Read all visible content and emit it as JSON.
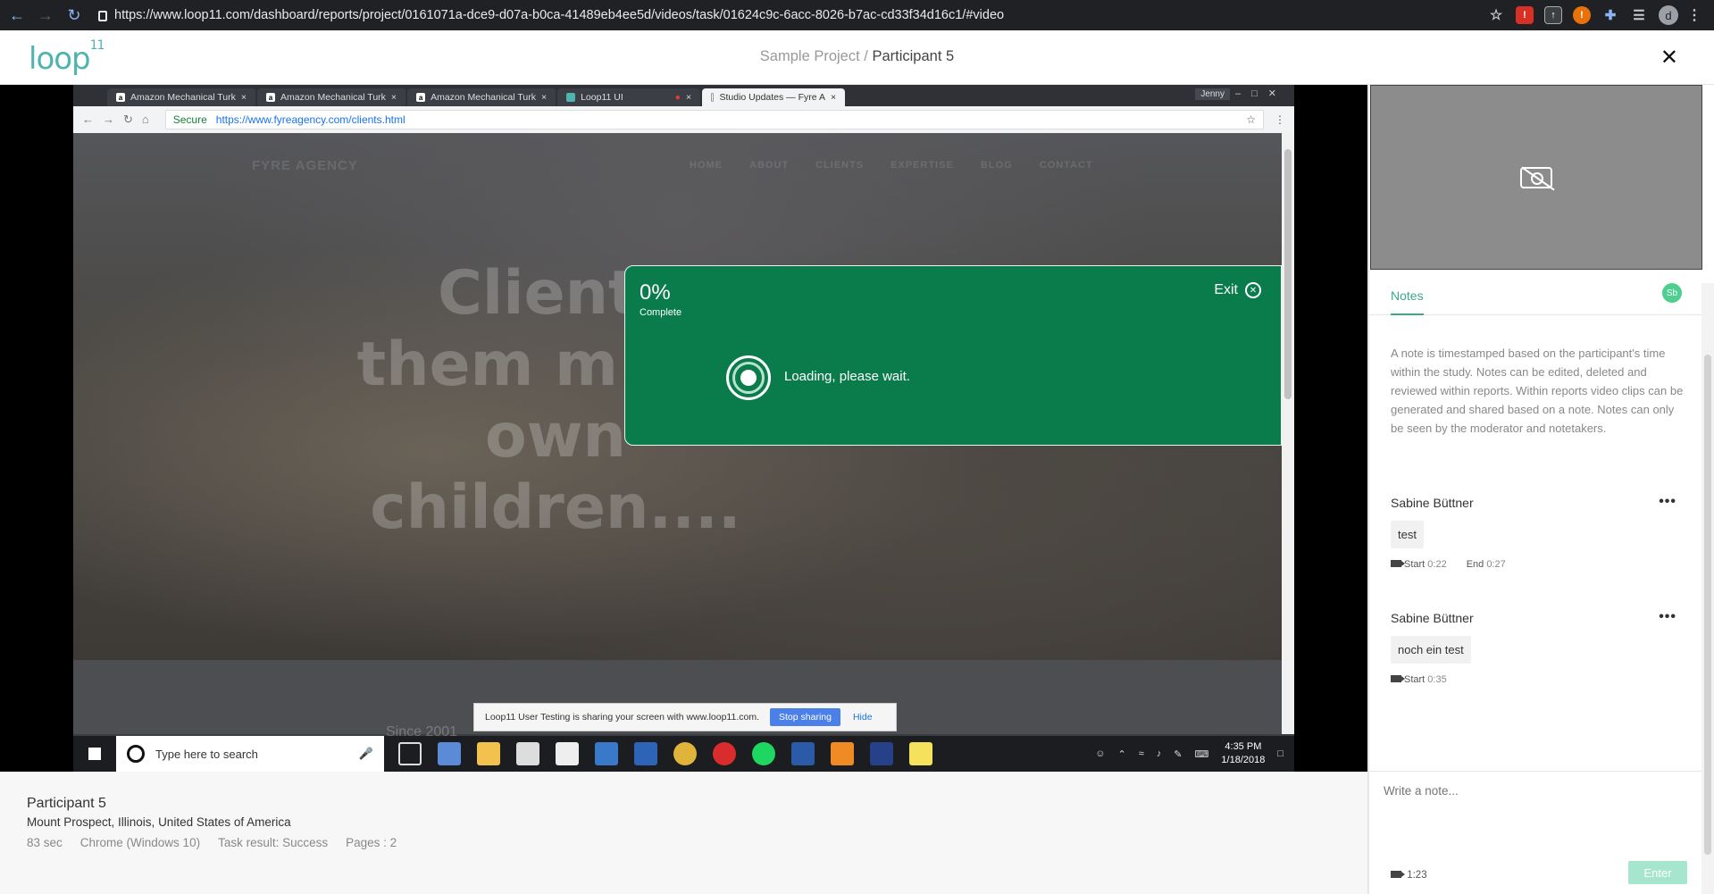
{
  "browser": {
    "url": "https://www.loop11.com/dashboard/reports/project/0161071a-dce9-d07a-b0ca-41489eb4ee5d/videos/task/01624c9c-6acc-8026-b7ac-cd33f34d16c1/#video",
    "avatar_letter": "d"
  },
  "header": {
    "logo": "loop",
    "logo_sup": "11",
    "project": "Sample Project",
    "separator": "/",
    "participant": "Participant 5"
  },
  "recording": {
    "tabs": [
      {
        "label": "Amazon Mechanical Turk"
      },
      {
        "label": "Amazon Mechanical Turk"
      },
      {
        "label": "Amazon Mechanical Turk"
      },
      {
        "label": "Loop11 UI"
      },
      {
        "label": "Studio Updates — Fyre A"
      }
    ],
    "user": "Jenny",
    "secure_label": "Secure",
    "address": "https://www.fyreagency.com/clients.html",
    "site_brand": "FYRE AGENCY",
    "site_menu": [
      "HOME",
      "ABOUT",
      "CLIENTS",
      "EXPERTISE",
      "BLOG",
      "CONTACT"
    ],
    "site_headline": "Clients them m our own children....",
    "site_lower_text": "Since 2001",
    "overlay": {
      "percent": "0%",
      "complete_label": "Complete",
      "exit_label": "Exit",
      "loading_text": "Loading, please wait."
    },
    "share_bar": {
      "message": "Loop11 User Testing is sharing your screen with www.loop11.com.",
      "stop_label": "Stop sharing",
      "hide_label": "Hide"
    },
    "taskbar": {
      "search_placeholder": "Type here to search",
      "time": "4:35 PM",
      "date": "1/18/2018"
    }
  },
  "participant_info": {
    "name": "Participant 5",
    "location": "Mount Prospect, Illinois, United States of America",
    "duration": "83 sec",
    "browser": "Chrome (Windows 10)",
    "task_result": "Task result: Success",
    "pages": "Pages : 2"
  },
  "notes_panel": {
    "tab_label": "Notes",
    "user_badge": "Sb",
    "intro": "A note is timestamped based on the participant's time within the study. Notes can be edited, deleted and reviewed within reports. Within reports video clips can be generated and shared based on a note. Notes can only be seen by the moderator and notetakers.",
    "notes": [
      {
        "author": "Sabine Büttner",
        "text": "test",
        "start_label": "Start",
        "start": "0:22",
        "end_label": "End",
        "end": "0:27"
      },
      {
        "author": "Sabine Büttner",
        "text": "noch ein test",
        "start_label": "Start",
        "start": "0:35"
      }
    ],
    "compose_placeholder": "Write a note...",
    "compose_time": "1:23",
    "enter_label": "Enter"
  }
}
